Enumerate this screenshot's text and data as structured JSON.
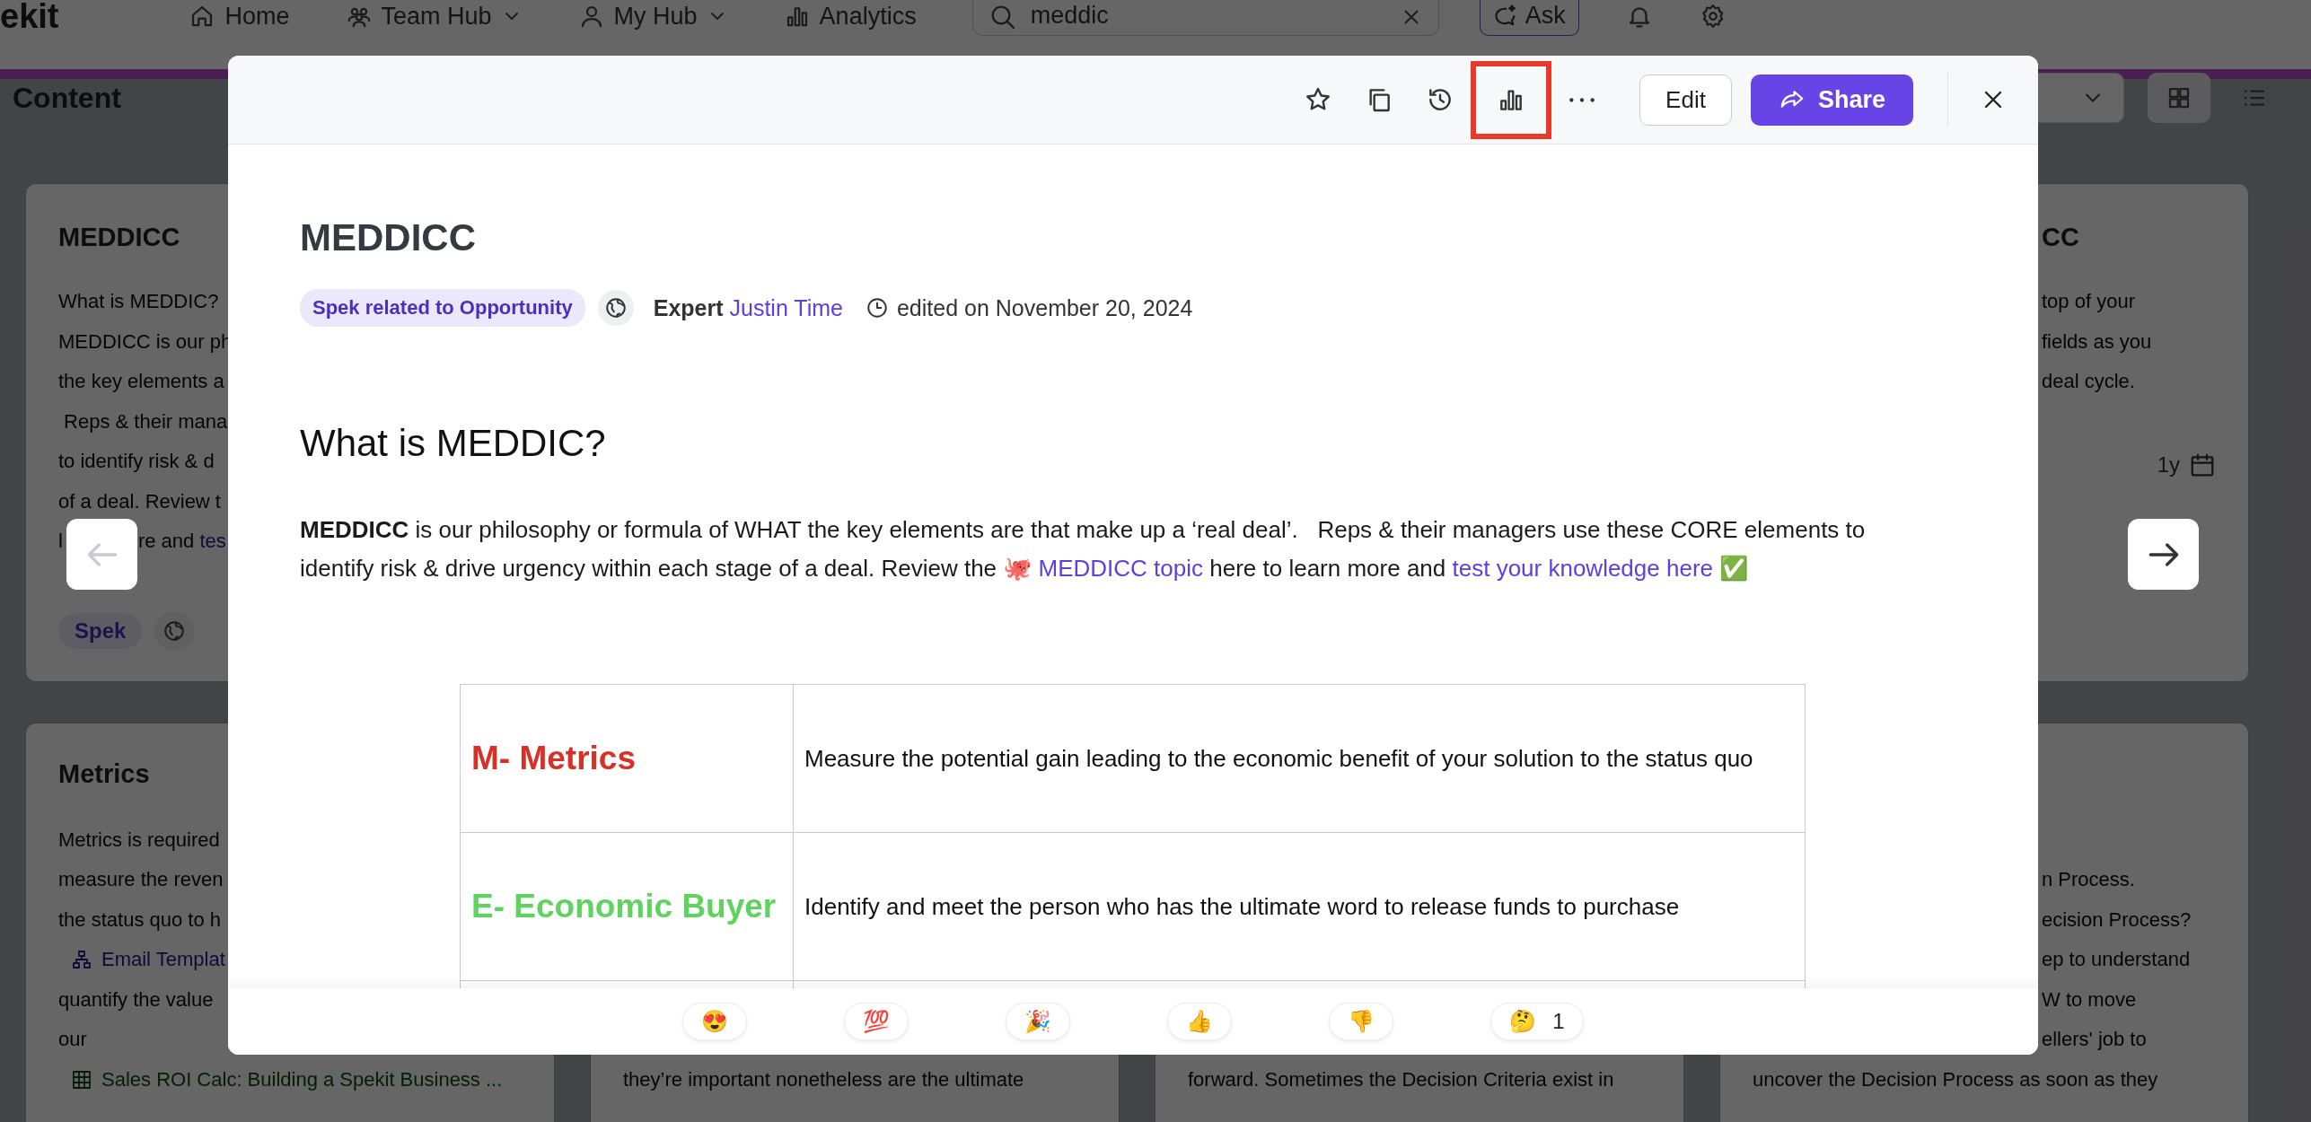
{
  "nav": {
    "logo": "ekit",
    "items": [
      {
        "kind": "home",
        "label": "Home",
        "dropdown": false
      },
      {
        "kind": "team",
        "label": "Team Hub",
        "dropdown": true
      },
      {
        "kind": "person",
        "label": "My Hub",
        "dropdown": true
      },
      {
        "kind": "analytics",
        "label": "Analytics",
        "dropdown": false
      }
    ],
    "search": {
      "value": "meddic"
    },
    "ask": "Ask"
  },
  "content_header": {
    "title": "Content",
    "view_toggle": [
      {
        "kind": "grid",
        "selected": true
      },
      {
        "kind": "list",
        "selected": false
      }
    ]
  },
  "columns": [
    {
      "top_card": {
        "title": {
          "text": "MEDDICC",
          "covered": false
        },
        "lines": [
          {
            "segments": [
              {
                "kind": "text",
                "text": "What is MEDDIC?"
              }
            ],
            "covered": false
          },
          {
            "segments": [
              {
                "kind": "text",
                "text": "MEDDICC is our ph"
              }
            ],
            "covered": false
          },
          {
            "segments": [
              {
                "kind": "text",
                "text": "the key elements a"
              }
            ],
            "covered": false
          },
          {
            "segments": [
              {
                "kind": "text",
                "text": " Reps & their mana"
              }
            ],
            "covered": false
          },
          {
            "segments": [
              {
                "kind": "text",
                "text": "to identify risk & d"
              }
            ],
            "covered": false
          },
          {
            "segments": [
              {
                "kind": "text",
                "text": "of a deal. Review t"
              }
            ],
            "covered": false
          },
          {
            "segments": [
              {
                "kind": "text",
                "text": "l"
              },
              {
                "kind": "text",
                "text": "re and "
              },
              {
                "kind": "link",
                "text": "tes"
              }
            ],
            "covered": false,
            "split": true
          }
        ],
        "footer": [
          {
            "kind": "tag",
            "text": "Spek"
          },
          {
            "kind": "globe"
          }
        ]
      },
      "bottom_card": {
        "title": {
          "text": "Metrics",
          "covered": false
        },
        "lines": [
          {
            "segments": [
              {
                "kind": "text",
                "text": "Metrics is required"
              }
            ],
            "covered": false
          },
          {
            "segments": [
              {
                "kind": "text",
                "text": "measure the reven"
              }
            ],
            "covered": false
          },
          {
            "segments": [
              {
                "kind": "text",
                "text": "the status quo to h"
              }
            ],
            "covered": false
          },
          {
            "segments": [
              {
                "kind": "topic_link",
                "text": "Email Templat"
              }
            ],
            "covered": false
          },
          {
            "segments": [
              {
                "kind": "text",
                "text": "quantify the value"
              }
            ],
            "covered": false
          },
          {
            "segments": [
              {
                "kind": "text",
                "text": "our"
              }
            ],
            "covered": false
          },
          {
            "segments": [
              {
                "kind": "sheet_link",
                "text": "Sales ROI Calc: Building a Spekit Business ..."
              }
            ],
            "covered": false
          }
        ]
      }
    },
    {
      "bottom_card": {
        "lines": [
          {
            "segments": [
              {
                "kind": "text",
                "text": "they’re important nonetheless are the ultimate"
              }
            ],
            "covered": false
          }
        ]
      }
    },
    {
      "bottom_card": {
        "lines": [
          {
            "segments": [
              {
                "kind": "text",
                "text": "forward. Sometimes the Decision Criteria exist in"
              }
            ],
            "covered": false
          }
        ]
      }
    },
    {
      "top_card": {
        "title": {
          "text": "CC",
          "covered": true
        },
        "lines": [
          {
            "segments": [
              {
                "kind": "text",
                "text": "top of your"
              }
            ],
            "covered": true
          },
          {
            "segments": [
              {
                "kind": "text",
                "text": "fields as you"
              }
            ],
            "covered": true
          },
          {
            "segments": [
              {
                "kind": "text",
                "text": "deal cycle."
              }
            ],
            "covered": true
          }
        ],
        "footer": [
          {
            "kind": "age",
            "text": "1y"
          }
        ]
      },
      "bottom_card": {
        "lines": [
          {
            "segments": [
              {
                "kind": "text",
                "text": "n Process."
              }
            ],
            "covered": true
          },
          {
            "segments": [
              {
                "kind": "text",
                "text": "ecision Process?"
              }
            ],
            "covered": true
          },
          {
            "segments": [
              {
                "kind": "text",
                "text": "ep to understand"
              }
            ],
            "covered": true
          },
          {
            "segments": [
              {
                "kind": "text",
                "text": "W to move"
              }
            ],
            "covered": true
          },
          {
            "segments": [
              {
                "kind": "text",
                "text": "ellers' job to"
              }
            ],
            "covered": true
          },
          {
            "segments": [
              {
                "kind": "text",
                "text": "uncover the Decision Process as soon as they"
              }
            ],
            "covered": false
          }
        ]
      }
    }
  ],
  "pager": {
    "previous": {
      "disabled": true
    },
    "next": {
      "disabled": false
    }
  },
  "modal": {
    "toolbar": {
      "buttons": [
        {
          "kind": "star",
          "highlighted": false
        },
        {
          "kind": "copy",
          "highlighted": false
        },
        {
          "kind": "history",
          "highlighted": false
        },
        {
          "kind": "stats",
          "highlighted": true
        },
        {
          "kind": "more",
          "highlighted": false
        }
      ],
      "edit": "Edit",
      "share": "Share"
    },
    "title": "MEDDICC",
    "meta": {
      "tag": "Spek related to Opportunity",
      "expert_label": "Expert",
      "expert_name": "Justin Time",
      "edited": "edited on November 20, 2024"
    },
    "heading": "What is MEDDIC?",
    "paragraph": [
      {
        "kind": "bold",
        "text": "MEDDICC"
      },
      {
        "kind": "text",
        "text": " is our philosophy or formula of WHAT the key elements are that make up a ‘real deal’.   Reps & their managers use these CORE elements to identify risk & drive urgency within each stage of a deal. Review the 🐙 "
      },
      {
        "kind": "link",
        "text": "MEDDICC topic"
      },
      {
        "kind": "text",
        "text": " here to learn more and "
      },
      {
        "kind": "link",
        "text": "test your knowledge here"
      },
      {
        "kind": "text",
        "text": " ✅"
      }
    ],
    "table": [
      {
        "label": "M- Metrics",
        "color": "#d93025",
        "description": "Measure the potential gain leading to the economic benefit of your solution to the status quo"
      },
      {
        "label": "E- Economic Buyer",
        "color": "#5fd35f",
        "description": "Identify and meet the person who has the ultimate word to release funds to purchase"
      }
    ],
    "reactions": [
      {
        "emoji": "😍"
      },
      {
        "emoji": "💯"
      },
      {
        "emoji": "🎉"
      },
      {
        "emoji": "👍"
      },
      {
        "emoji": "👎"
      },
      {
        "emoji": "🤔",
        "count": "1"
      }
    ]
  }
}
